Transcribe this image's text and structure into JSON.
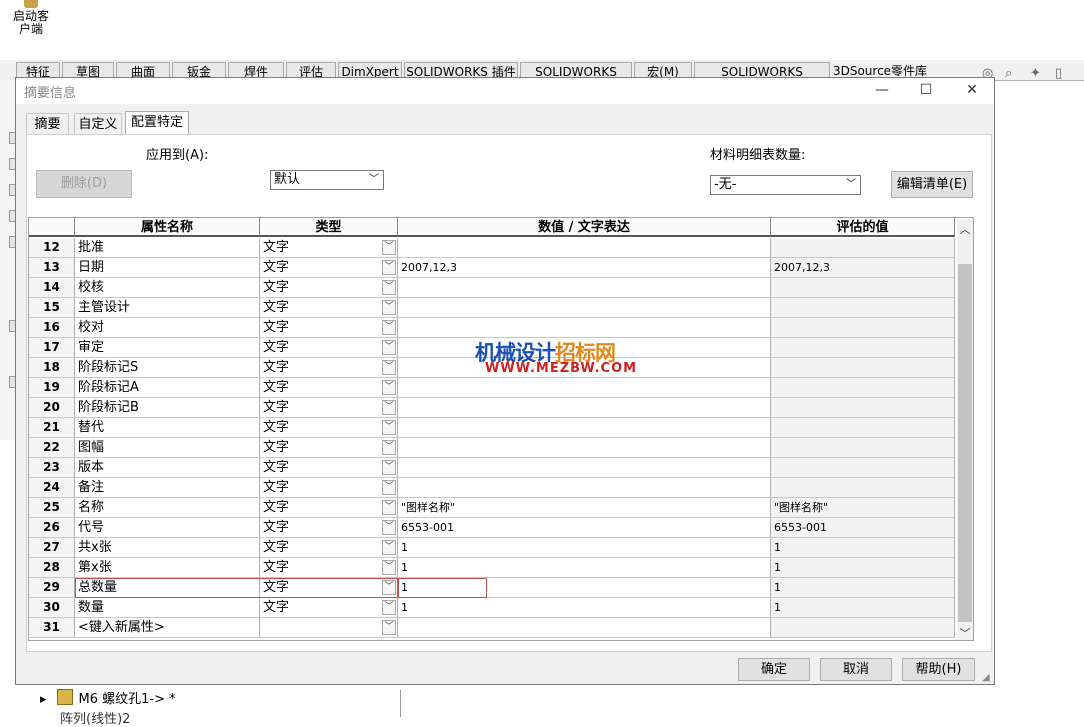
{
  "app": {
    "launch_label_1": "启动客",
    "launch_label_2": "户端",
    "tabs": [
      "特征",
      "草图",
      "曲面",
      "钣金",
      "焊件",
      "评估",
      "DimXpert",
      "SOLIDWORKS 插件",
      "SOLIDWORKS MBD",
      "宏(M)",
      "SOLIDWORKS Visualize",
      "3DSource零件库"
    ],
    "tree": {
      "item1": "M6 螺纹孔1-> *",
      "item2": "阵列(线性)2"
    }
  },
  "dialog": {
    "title": "摘要信息",
    "window_controls": {
      "minimize": "—",
      "maximize": "☐",
      "close": "✕"
    },
    "tabs": [
      "摘要",
      "自定义",
      "配置特定"
    ],
    "active_tab": "配置特定",
    "apply_to_label": "应用到(A):",
    "delete_button": "删除(D)",
    "config_value": "默认",
    "bom_qty_label": "材料明细表数量:",
    "bom_qty_value": "-无-",
    "edit_list_button": "编辑清单(E)",
    "grid": {
      "headers": [
        "属性名称",
        "类型",
        "数值 / 文字表达",
        "评估的值"
      ],
      "rows": [
        {
          "num": "12",
          "name": "批准",
          "type": "文字",
          "value": "",
          "eval": ""
        },
        {
          "num": "13",
          "name": "日期",
          "type": "文字",
          "value": "2007,12,3",
          "eval": "2007,12,3"
        },
        {
          "num": "14",
          "name": "校核",
          "type": "文字",
          "value": "",
          "eval": ""
        },
        {
          "num": "15",
          "name": "主管设计",
          "type": "文字",
          "value": "",
          "eval": ""
        },
        {
          "num": "16",
          "name": "校对",
          "type": "文字",
          "value": "",
          "eval": ""
        },
        {
          "num": "17",
          "name": "审定",
          "type": "文字",
          "value": "",
          "eval": ""
        },
        {
          "num": "18",
          "name": "阶段标记S",
          "type": "文字",
          "value": "",
          "eval": ""
        },
        {
          "num": "19",
          "name": "阶段标记A",
          "type": "文字",
          "value": "",
          "eval": ""
        },
        {
          "num": "20",
          "name": "阶段标记B",
          "type": "文字",
          "value": "",
          "eval": ""
        },
        {
          "num": "21",
          "name": "替代",
          "type": "文字",
          "value": "",
          "eval": ""
        },
        {
          "num": "22",
          "name": "图幅",
          "type": "文字",
          "value": "",
          "eval": ""
        },
        {
          "num": "23",
          "name": "版本",
          "type": "文字",
          "value": "",
          "eval": ""
        },
        {
          "num": "24",
          "name": "备注",
          "type": "文字",
          "value": "",
          "eval": ""
        },
        {
          "num": "25",
          "name": "名称",
          "type": "文字",
          "value": "\"图样名称\"",
          "eval": "\"图样名称\""
        },
        {
          "num": "26",
          "name": "代号",
          "type": "文字",
          "value": "6553-001",
          "eval": "6553-001"
        },
        {
          "num": "27",
          "name": "共x张",
          "type": "文字",
          "value": "1",
          "eval": "1"
        },
        {
          "num": "28",
          "name": "第x张",
          "type": "文字",
          "value": "1",
          "eval": "1"
        },
        {
          "num": "29",
          "name": "总数量",
          "type": "文字",
          "value": "1",
          "eval": "1"
        },
        {
          "num": "30",
          "name": "数量",
          "type": "文字",
          "value": "1",
          "eval": "1"
        },
        {
          "num": "31",
          "name": "<键入新属性>",
          "type": "",
          "value": "",
          "eval": ""
        }
      ]
    },
    "buttons": {
      "ok": "确定",
      "cancel": "取消",
      "help": "帮助(H)"
    }
  },
  "watermark": {
    "line1_a": "机械设计",
    "line1_b": "招标网",
    "line2": "WWW.MEZBW.COM"
  }
}
